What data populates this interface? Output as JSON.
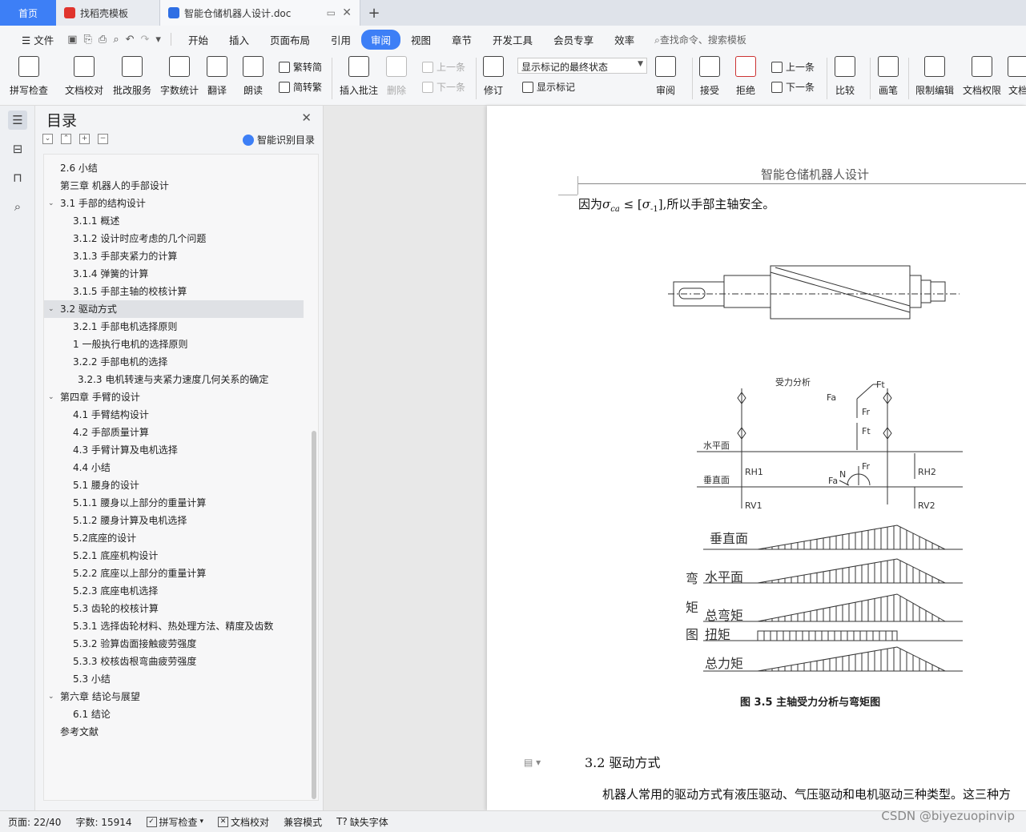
{
  "tabs": [
    {
      "label": "首页"
    },
    {
      "label": "找稻壳模板"
    },
    {
      "label": "智能仓储机器人设计.doc"
    }
  ],
  "menu": {
    "file": "文件",
    "items": [
      "开始",
      "插入",
      "页面布局",
      "引用",
      "审阅",
      "视图",
      "章节",
      "开发工具",
      "会员专享",
      "效率"
    ],
    "active": "审阅",
    "search": "查找命令、搜索模板"
  },
  "ribbon": {
    "spell": "拼写检查",
    "proof": "文档校对",
    "correction": "批改服务",
    "wordcount": "字数统计",
    "translate": "翻译",
    "read": "朗读",
    "trad": "繁转简",
    "simp": "简转繁",
    "insert_comment": "插入批注",
    "delete": "删除",
    "prev1": "上一条",
    "next1": "下一条",
    "revise": "修订",
    "markup_state": "显示标记的最终状态",
    "show_markup": "显示标记",
    "review": "审阅",
    "accept": "接受",
    "reject": "拒绝",
    "prev2": "上一条",
    "next2": "下一条",
    "compare": "比较",
    "pen": "画笔",
    "restrict": "限制编辑",
    "rights": "文档权限",
    "more": "文档"
  },
  "toc": {
    "title": "目录",
    "smart": "智能识别目录",
    "items": [
      {
        "text": "2.6  小结",
        "indent": 1
      },
      {
        "text": "第三章    机器人的手部设计",
        "indent": 1
      },
      {
        "text": "3.1  手部的结构设计",
        "indent": 1,
        "caret": true
      },
      {
        "text": "3.1.1  概述",
        "indent": 2
      },
      {
        "text": "3.1.2  设计时应考虑的几个问题",
        "indent": 2
      },
      {
        "text": "3.1.3  手部夹紧力的计算",
        "indent": 2
      },
      {
        "text": "3.1.4  弹簧的计算",
        "indent": 2
      },
      {
        "text": "3.1.5  手部主轴的校核计算",
        "indent": 2
      },
      {
        "text": "3.2  驱动方式",
        "indent": 1,
        "caret": true,
        "selected": true
      },
      {
        "text": "3.2.1  手部电机选择原则",
        "indent": 2
      },
      {
        "text": "1   一般执行电机的选择原则",
        "indent": 2
      },
      {
        "text": "3.2.2  手部电机的选择",
        "indent": 2
      },
      {
        "text": "3.2.3  电机转速与夹紧力速度几何关系的确定",
        "indent": 3
      },
      {
        "text": "第四章    手臂的设计",
        "indent": 1,
        "caret": true
      },
      {
        "text": "4.1  手臂结构设计",
        "indent": 2
      },
      {
        "text": "4.2  手部质量计算",
        "indent": 2
      },
      {
        "text": "4.3  手臂计算及电机选择",
        "indent": 2
      },
      {
        "text": "4.4    小结",
        "indent": 2
      },
      {
        "text": "5.1  腰身的设计",
        "indent": 2
      },
      {
        "text": "5.1.1  腰身以上部分的重量计算",
        "indent": 2
      },
      {
        "text": "5.1.2  腰身计算及电机选择",
        "indent": 2
      },
      {
        "text": "5.2底座的设计",
        "indent": 2
      },
      {
        "text": "5.2.1  底座机构设计",
        "indent": 2
      },
      {
        "text": "5.2.2  底座以上部分的重量计算",
        "indent": 2
      },
      {
        "text": "5.2.3  底座电机选择",
        "indent": 2
      },
      {
        "text": "5.3  齿轮的校核计算",
        "indent": 2
      },
      {
        "text": "5.3.1  选择齿轮材料、热处理方法、精度及齿数",
        "indent": 2
      },
      {
        "text": "5.3.2  验算齿面接触疲劳强度",
        "indent": 2
      },
      {
        "text": "5.3.3  校核齿根弯曲疲劳强度",
        "indent": 2
      },
      {
        "text": "5.3    小结",
        "indent": 2
      },
      {
        "text": "第六章  结论与展望",
        "indent": 1,
        "caret": true
      },
      {
        "text": "6.1  结论",
        "indent": 2
      },
      {
        "text": "参考文献",
        "indent": 1
      }
    ]
  },
  "doc": {
    "header": "智能仓储机器人设计",
    "line1_pre": "因为",
    "line1_sigma": "σ",
    "line1_sub": "ca",
    "line1_le": " ≤ [",
    "line1_sigma2": "σ",
    "line1_sub2": "-1",
    "line1_post": "],所以手部主轴安全。",
    "figure": {
      "title": "受力分析",
      "labels": {
        "horizontal_plane": "水平面",
        "vertical_plane": "垂直面",
        "fa": "Fa",
        "ft_top": "Ft",
        "fr_top": "Fr",
        "ft_mid": "Ft",
        "fr_mid": "Fr",
        "fa_low": "Fa",
        "n": "N",
        "rh1": "RH1",
        "rh2": "RH2",
        "rv1": "RV1",
        "rv2": "RV2",
        "d_vertical": "垂直面",
        "d_horizontal": "水平面",
        "d_total_bending": "总弯矩",
        "d_torque": "扭矩",
        "d_total_force": "总力矩",
        "side_1": "弯",
        "side_2": "矩",
        "side_3": "图"
      }
    },
    "caption": "图 3.5  主轴受力分析与弯矩图",
    "section_heading": "3.2  驱动方式",
    "paragraph": "机器人常用的驱动方式有液压驱动、气压驱动和电机驱动三种类型。这三种方"
  },
  "status": {
    "page": "页面: 22/40",
    "words": "字数: 15914",
    "spell": "拼写检查",
    "proof": "文档校对",
    "compat": "兼容模式",
    "missing_font": "缺失字体"
  },
  "watermark": "CSDN @biyezuopinvip"
}
